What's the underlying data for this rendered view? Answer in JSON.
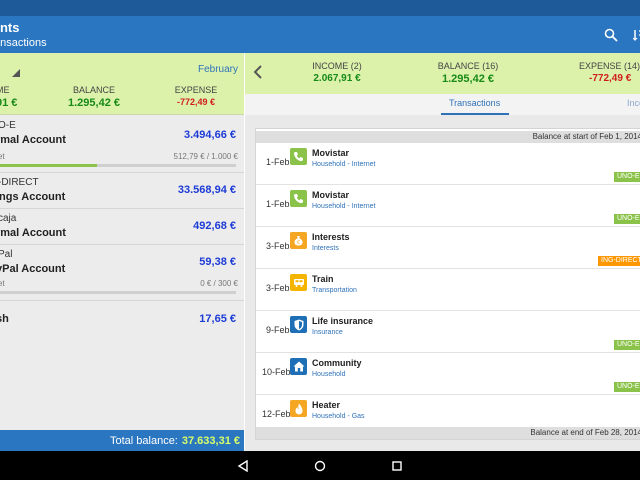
{
  "app_bar": {
    "title": "unts",
    "subtitle": "ansactions"
  },
  "summary_left": {
    "month": "February",
    "income_label": "ME",
    "income_value": "91 €",
    "balance_label": "BALANCE",
    "balance_value": "1.295,42 €",
    "expense_label": "EXPENSE",
    "expense_value": "-772,49 €"
  },
  "accounts": [
    {
      "bank": "O-E",
      "name": "rmal Account",
      "balance": "3.494,66 €",
      "budget_label": "et",
      "budget_text": "512,79 € / 1.000 €",
      "progress": 0.41
    },
    {
      "bank": "-DIRECT",
      "name": "ings Account",
      "balance": "33.568,94 €"
    },
    {
      "bank": "caja",
      "name": "rmal Account",
      "balance": "492,68 €"
    },
    {
      "bank": "Pal",
      "name": "yPal Account",
      "balance": "59,38 €",
      "budget_label": "et",
      "budget_text": "0 € / 300 €",
      "progress": 0
    },
    {
      "bank": "",
      "name": "sh",
      "balance": "17,65 €"
    }
  ],
  "total": {
    "label": "Total balance:",
    "value": "37.633,31 €"
  },
  "summary_right": {
    "income_label": "INCOME (2)",
    "income_value": "2.067,91 €",
    "balance_label": "BALANCE (16)",
    "balance_value": "1.295,42 €",
    "expense_label": "EXPENSE (14)",
    "expense_value": "-772,49 €"
  },
  "tabs": {
    "transactions": "Transactions",
    "income": "Inco"
  },
  "balance_start": "Balance at start of Feb 1, 2014",
  "balance_end": "Balance at end of Feb 28, 2014",
  "transactions": [
    {
      "date": "1-Feb",
      "title": "Movistar",
      "category": "Household - Internet",
      "tag": "UNO-E",
      "icon": "phone-icon",
      "icon_color": "#8bc34a"
    },
    {
      "date": "1-Feb",
      "title": "Movistar",
      "category": "Household - Internet",
      "tag": "UNO-E",
      "icon": "phone-icon",
      "icon_color": "#8bc34a"
    },
    {
      "date": "3-Feb",
      "title": "Interests",
      "category": "Interests",
      "tag": "ING-DIRECT -",
      "icon": "money-bag-icon",
      "icon_color": "#f5a623"
    },
    {
      "date": "3-Feb",
      "title": "Train",
      "category": "Transportation",
      "tag": "",
      "icon": "train-icon",
      "icon_color": "#f5b400"
    },
    {
      "date": "9-Feb",
      "title": "Life insurance",
      "category": "Insurance",
      "tag": "UNO-E",
      "icon": "shield-icon",
      "icon_color": "#1e6fb5"
    },
    {
      "date": "10-Feb",
      "title": "Community",
      "category": "Household",
      "tag": "UNO-E",
      "icon": "house-icon",
      "icon_color": "#1e6fb5"
    },
    {
      "date": "12-Feb",
      "title": "Heater",
      "category": "Household - Gas",
      "tag": "",
      "icon": "flame-icon",
      "icon_color": "#f5a623"
    }
  ],
  "colors": {
    "primary": "#2b76c0",
    "status_bar": "#1e5a9a",
    "summary_bg": "#dcf2ab",
    "tag_green": "#8bc34a",
    "tag_orange": "#ff9800"
  }
}
